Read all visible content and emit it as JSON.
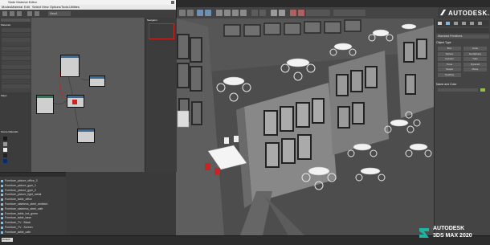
{
  "app": {
    "brand": "AUTODESK.",
    "product_footer": "AUTODESK",
    "product_footer_2": "3DS MAX 2020"
  },
  "slate": {
    "title": "Slate Material Editor",
    "menu": [
      "Modes",
      "Material",
      "Edit",
      "Select",
      "View",
      "Options",
      "Tools",
      "Utilities"
    ],
    "viewport_tab": "View1",
    "browser_header": "Material/Map Browser",
    "browser_groups": [
      "Materials",
      "Maps",
      "Controllers",
      "Scene Materials"
    ],
    "navigator": "Navigator"
  },
  "explorer": {
    "items": [
      "Furniture_picture_office_3",
      "Furniture_picture_gym_1",
      "Furniture_picture_gym_2",
      "Furniture_picture_light_metal",
      "Furniture_table_office",
      "Furniture_stainless_steel_ambient",
      "Furniture_stainless_steel_cafe",
      "Furniture_table_hot_green",
      "Furniture_table_base",
      "Furniture_TV - Black",
      "Furniture_TV - Screen",
      "Furniture_table_cafe"
    ]
  },
  "command_panel": {
    "section1": "Standard Primitives",
    "section2": "Object Type",
    "buttons": [
      "Box",
      "Cone",
      "Sphere",
      "GeoSphere",
      "Cylinder",
      "Tube",
      "Torus",
      "Pyramid",
      "Teapot",
      "Plane",
      "TextPlus"
    ],
    "section3": "Name and Color"
  },
  "status": {
    "selection": "Default"
  },
  "colors": {
    "accent_red": "#cc2222",
    "node_green": "#2a7a5a",
    "node_blue": "#3a6a9a"
  }
}
